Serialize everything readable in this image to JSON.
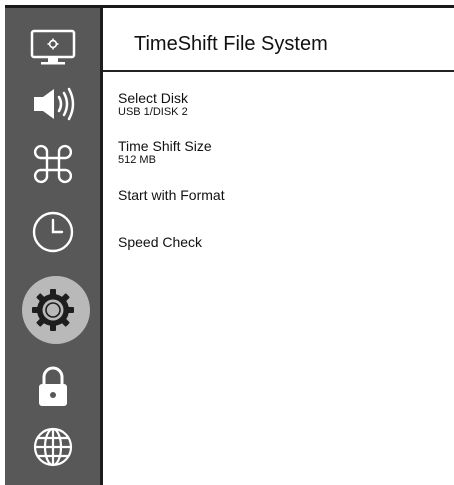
{
  "sidebar": {
    "items": [
      {
        "icon": "display-settings-icon",
        "active": false
      },
      {
        "icon": "speaker-volume-icon",
        "active": false
      },
      {
        "icon": "command-key-icon",
        "active": false
      },
      {
        "icon": "clock-icon",
        "active": false
      },
      {
        "icon": "gear-icon",
        "active": true
      },
      {
        "icon": "lock-icon",
        "active": false
      },
      {
        "icon": "globe-icon",
        "active": false
      }
    ],
    "colors": {
      "background": "#585858",
      "icon": "#ffffff",
      "active_halo": "#b9b9b9",
      "active_icon": "#1e1e1e"
    }
  },
  "panel": {
    "title": "TimeShift File System",
    "items": [
      {
        "label": "Select Disk",
        "value": "USB 1/DISK 2"
      },
      {
        "label": "Time Shift Size",
        "value": "512 MB"
      },
      {
        "label": "Start with Format"
      },
      {
        "label": "Speed Check"
      }
    ]
  }
}
